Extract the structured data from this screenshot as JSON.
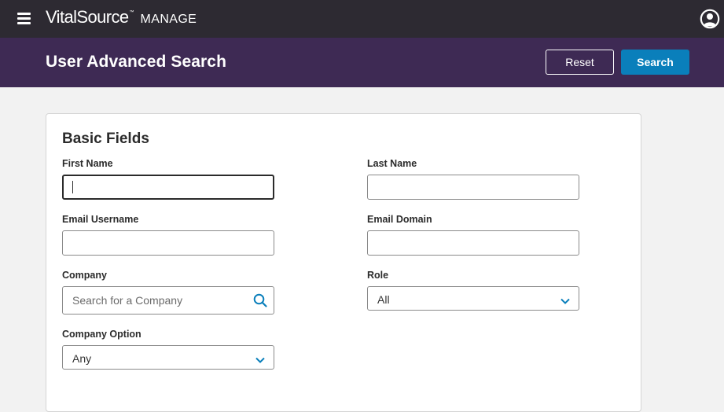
{
  "app": {
    "brand_name": "VitalSource",
    "brand_tm": "™",
    "brand_product": "MANAGE",
    "menu_icon": "hamburger-menu-icon",
    "account_icon": "user-account-icon"
  },
  "header": {
    "title": "User Advanced Search",
    "reset_label": "Reset",
    "search_label": "Search"
  },
  "form": {
    "section_title": "Basic Fields",
    "first_name": {
      "label": "First Name",
      "value": "",
      "placeholder": ""
    },
    "last_name": {
      "label": "Last Name",
      "value": "",
      "placeholder": ""
    },
    "email_username": {
      "label": "Email Username",
      "value": "",
      "placeholder": ""
    },
    "email_domain": {
      "label": "Email Domain",
      "value": "",
      "placeholder": ""
    },
    "company": {
      "label": "Company",
      "value": "",
      "placeholder": "Search for a Company",
      "icon": "search-icon"
    },
    "role": {
      "label": "Role",
      "selected": "All"
    },
    "company_option": {
      "label": "Company Option",
      "selected": "Any"
    }
  },
  "colors": {
    "topbar": "#2d2a32",
    "header_band": "#3e2a54",
    "primary_button": "#0a7fbb",
    "accent_icon": "#0a7fbb",
    "page_background": "#f2f2f2"
  }
}
